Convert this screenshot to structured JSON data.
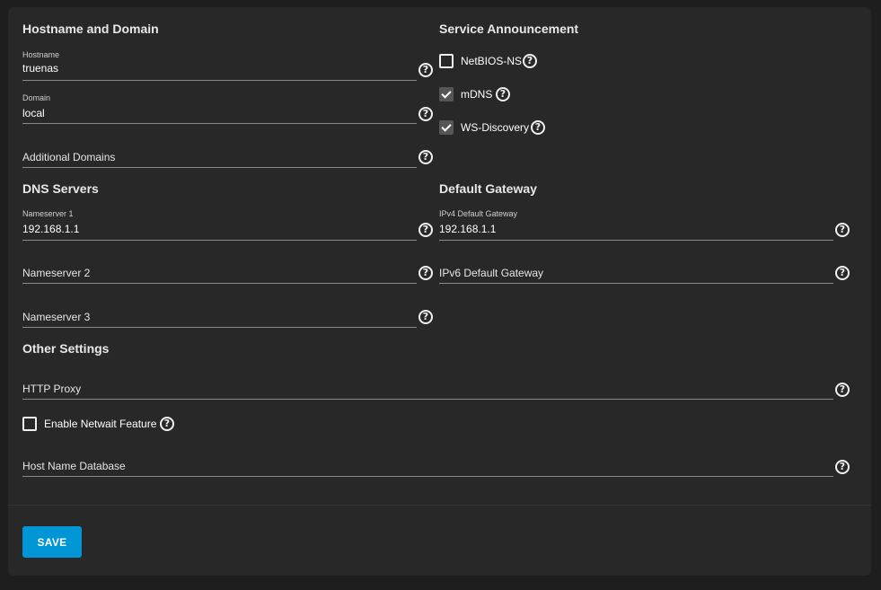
{
  "sections": {
    "hostname_domain": "Hostname and Domain",
    "service_announcement": "Service Announcement",
    "dns_servers": "DNS Servers",
    "default_gateway": "Default Gateway",
    "other_settings": "Other Settings"
  },
  "hostname": {
    "label": "Hostname",
    "value": "truenas"
  },
  "domain": {
    "label": "Domain",
    "value": "local"
  },
  "additional_domains": {
    "placeholder": "Additional Domains"
  },
  "nameserver1": {
    "label": "Nameserver 1",
    "value": "192.168.1.1"
  },
  "nameserver2": {
    "placeholder": "Nameserver 2"
  },
  "nameserver3": {
    "placeholder": "Nameserver 3"
  },
  "ipv4_gateway": {
    "label": "IPv4 Default Gateway",
    "value": "192.168.1.1"
  },
  "ipv6_gateway": {
    "placeholder": "IPv6 Default Gateway"
  },
  "service": {
    "netbios": {
      "label": "NetBIOS-NS",
      "checked": false
    },
    "mdns": {
      "label": "mDNS",
      "checked": true
    },
    "wsdiscovery": {
      "label": "WS-Discovery",
      "checked": true
    }
  },
  "http_proxy": {
    "placeholder": "HTTP Proxy"
  },
  "netwait": {
    "label": "Enable Netwait Feature",
    "checked": false
  },
  "host_name_db": {
    "placeholder": "Host Name Database"
  },
  "help_glyph": "?",
  "save_label": "SAVE",
  "icons": {
    "help": "help-circle-icon",
    "check": "checkmark-icon"
  }
}
